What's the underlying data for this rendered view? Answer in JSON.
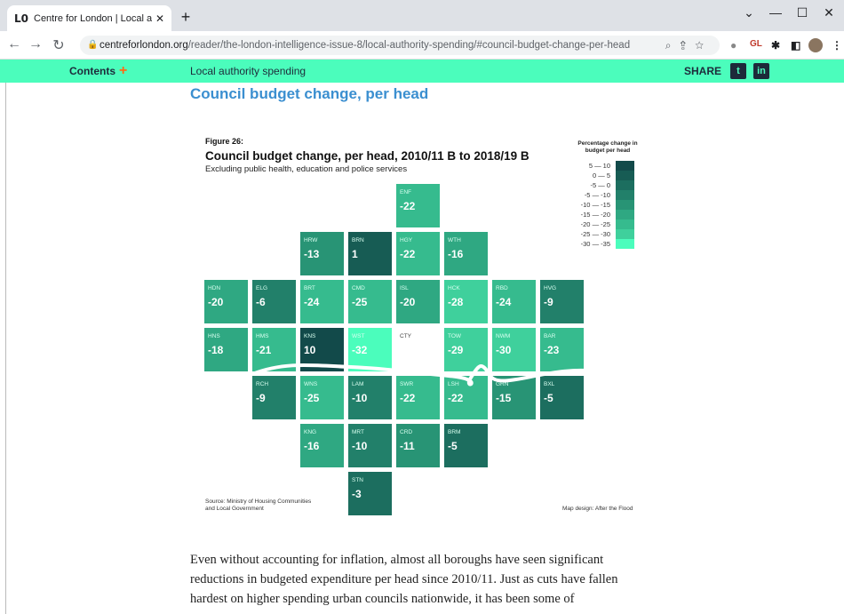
{
  "browser": {
    "tab_title": "Centre for London | Local authori",
    "tab_favicon": "L0",
    "tab_close": "✕",
    "new_tab": "+",
    "url_host": "centreforlondon.org",
    "url_path": "/reader/the-london-intelligence-issue-8/local-authority-spending/#council-budget-change-per-head",
    "ext_gl": "GL",
    "win_min": "—",
    "win_max": "☐",
    "win_close": "✕",
    "win_chevron": "⌄"
  },
  "sitebar": {
    "contents": "Contents",
    "contents_plus": "+",
    "breadcrumb": "Local authority spending",
    "share": "SHARE",
    "twitter": "t",
    "linkedin": "in"
  },
  "heading": "Council budget change, per head",
  "figure": {
    "label": "Figure 26:",
    "title": "Council budget change, per head, 2010/11 B to 2018/19 B",
    "subtitle": "Excluding public health, education and police services",
    "legend_title": "Percentage change in budget per head",
    "legend": [
      {
        "label": "5 — 10",
        "color": "#124a4a"
      },
      {
        "label": "0 — 5",
        "color": "#175c54"
      },
      {
        "label": "-5 — 0",
        "color": "#1c6e5f"
      },
      {
        "label": "-5 — -10",
        "color": "#22806a"
      },
      {
        "label": "-10 — -15",
        "color": "#289475"
      },
      {
        "label": "-15 — -20",
        "color": "#2fa882"
      },
      {
        "label": "-20 — -25",
        "color": "#36bb8e"
      },
      {
        "label": "-25 — -30",
        "color": "#3fd09c"
      },
      {
        "label": "-30 — -35",
        "color": "#4bfdbc"
      }
    ],
    "source": "Source: Ministry of Housing Communities and Local Government",
    "map_credit": "Map design: After the Flood"
  },
  "chart_data": {
    "type": "heatmap",
    "title": "Council budget change, per head, 2010/11 B to 2018/19 B",
    "subtitle": "Excluding public health, education and police services",
    "legend_title": "Percentage change in budget per head",
    "boroughs": [
      {
        "code": "ENF",
        "value": -22,
        "row": 0,
        "col": 4
      },
      {
        "code": "HRW",
        "value": -13,
        "row": 1,
        "col": 2
      },
      {
        "code": "BRN",
        "value": 1,
        "row": 1,
        "col": 3
      },
      {
        "code": "HGY",
        "value": -22,
        "row": 1,
        "col": 4
      },
      {
        "code": "WTH",
        "value": -16,
        "row": 1,
        "col": 5
      },
      {
        "code": "HDN",
        "value": -20,
        "row": 2,
        "col": 0
      },
      {
        "code": "ELG",
        "value": -6,
        "row": 2,
        "col": 1
      },
      {
        "code": "BRT",
        "value": -24,
        "row": 2,
        "col": 2
      },
      {
        "code": "CMD",
        "value": -25,
        "row": 2,
        "col": 3
      },
      {
        "code": "ISL",
        "value": -20,
        "row": 2,
        "col": 4
      },
      {
        "code": "HCK",
        "value": -28,
        "row": 2,
        "col": 5
      },
      {
        "code": "RBD",
        "value": -24,
        "row": 2,
        "col": 6
      },
      {
        "code": "HVG",
        "value": -9,
        "row": 2,
        "col": 7
      },
      {
        "code": "HNS",
        "value": -18,
        "row": 3,
        "col": 0
      },
      {
        "code": "HMS",
        "value": -21,
        "row": 3,
        "col": 1
      },
      {
        "code": "KNS",
        "value": 10,
        "row": 3,
        "col": 2
      },
      {
        "code": "WST",
        "value": -32,
        "row": 3,
        "col": 3
      },
      {
        "code": "CTY",
        "value": null,
        "row": 3,
        "col": 4
      },
      {
        "code": "TOW",
        "value": -29,
        "row": 3,
        "col": 5
      },
      {
        "code": "NWM",
        "value": -30,
        "row": 3,
        "col": 6
      },
      {
        "code": "BAR",
        "value": -23,
        "row": 3,
        "col": 7
      },
      {
        "code": "RCH",
        "value": -9,
        "row": 4,
        "col": 1
      },
      {
        "code": "WNS",
        "value": -25,
        "row": 4,
        "col": 2
      },
      {
        "code": "LAM",
        "value": -10,
        "row": 4,
        "col": 3
      },
      {
        "code": "SWR",
        "value": -22,
        "row": 4,
        "col": 4
      },
      {
        "code": "LSH",
        "value": -22,
        "row": 4,
        "col": 5
      },
      {
        "code": "GRN",
        "value": -15,
        "row": 4,
        "col": 6
      },
      {
        "code": "BXL",
        "value": -5,
        "row": 4,
        "col": 7
      },
      {
        "code": "KNG",
        "value": -16,
        "row": 5,
        "col": 2
      },
      {
        "code": "MRT",
        "value": -10,
        "row": 5,
        "col": 3
      },
      {
        "code": "CRD",
        "value": -11,
        "row": 5,
        "col": 4
      },
      {
        "code": "BRM",
        "value": -5,
        "row": 5,
        "col": 5
      },
      {
        "code": "STN",
        "value": -3,
        "row": 6,
        "col": 3
      }
    ]
  },
  "paragraph": [
    "Even without accounting for inflation, almost all boroughs have seen significant",
    "reductions in budgeted expenditure per head since 2010/11. Just as cuts have fallen",
    "hardest on higher spending urban councils nationwide, it has been some of"
  ]
}
